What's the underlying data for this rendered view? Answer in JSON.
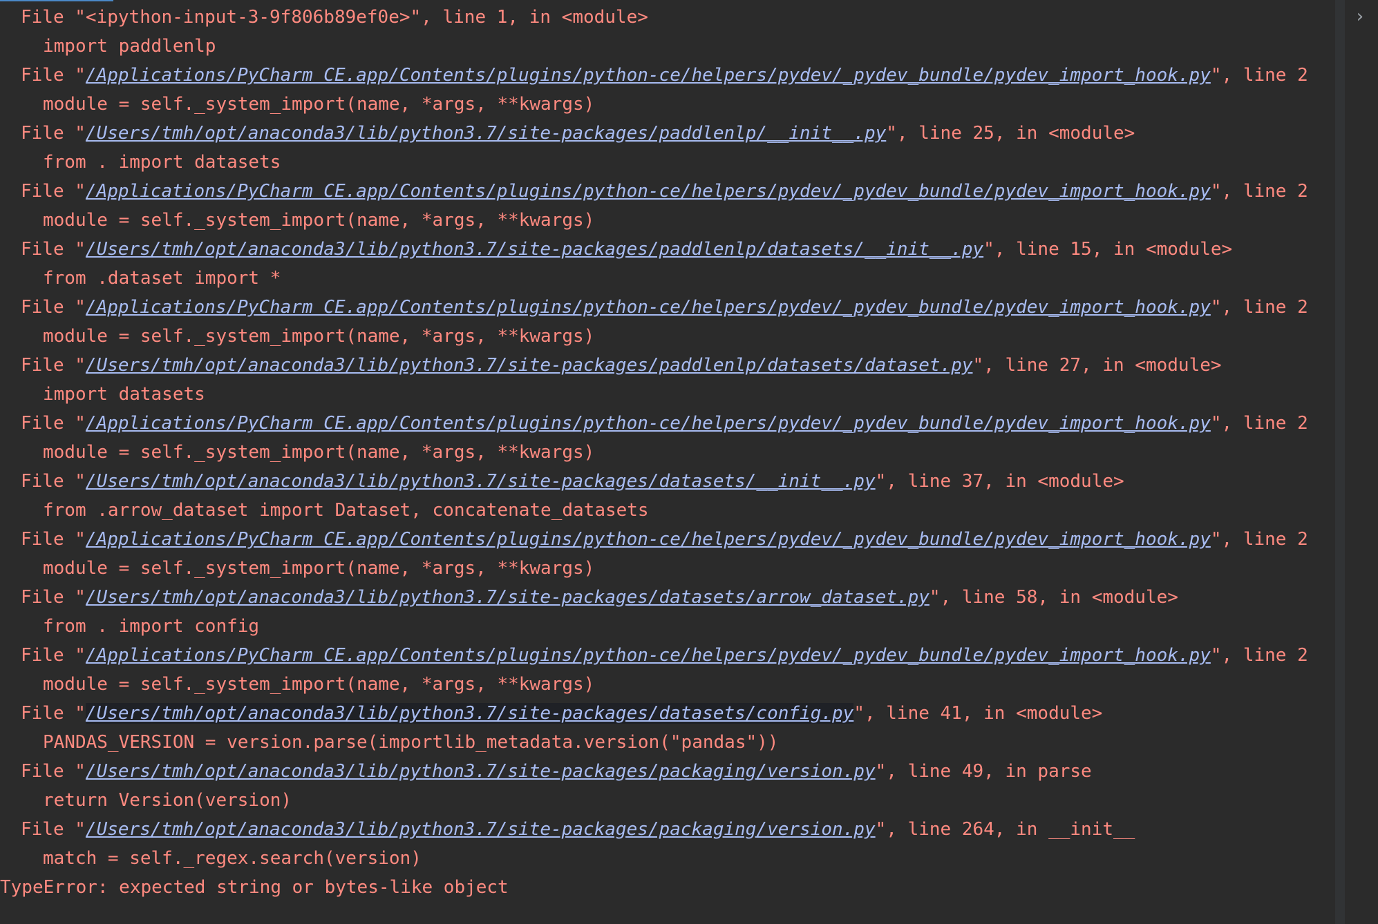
{
  "colors": {
    "background": "#2b2b2b",
    "error_text": "#ff8a80",
    "link": "#a8bcf2",
    "accent": "#4a88c7"
  },
  "icons": {
    "expand": "chevron-right-icon"
  },
  "traceback": [
    {
      "type": "file",
      "pre": "File \"",
      "link": "",
      "post": "<ipython-input-3-9f806b89ef0e>\", line 1, in <module>"
    },
    {
      "type": "code",
      "text": "import paddlenlp"
    },
    {
      "type": "file",
      "pre": "File \"",
      "link": "/Applications/PyCharm CE.app/Contents/plugins/python-ce/helpers/pydev/_pydev_bundle/pydev_import_hook.py",
      "post": "\", line 2"
    },
    {
      "type": "code",
      "text": "module = self._system_import(name, *args, **kwargs)"
    },
    {
      "type": "file",
      "pre": "File \"",
      "link": "/Users/tmh/opt/anaconda3/lib/python3.7/site-packages/paddlenlp/__init__.py",
      "post": "\", line 25, in <module>"
    },
    {
      "type": "code",
      "text": "from . import datasets"
    },
    {
      "type": "file",
      "pre": "File \"",
      "link": "/Applications/PyCharm CE.app/Contents/plugins/python-ce/helpers/pydev/_pydev_bundle/pydev_import_hook.py",
      "post": "\", line 2"
    },
    {
      "type": "code",
      "text": "module = self._system_import(name, *args, **kwargs)"
    },
    {
      "type": "file",
      "pre": "File \"",
      "link": "/Users/tmh/opt/anaconda3/lib/python3.7/site-packages/paddlenlp/datasets/__init__.py",
      "post": "\", line 15, in <module>"
    },
    {
      "type": "code",
      "text": "from .dataset import *"
    },
    {
      "type": "file",
      "pre": "File \"",
      "link": "/Applications/PyCharm CE.app/Contents/plugins/python-ce/helpers/pydev/_pydev_bundle/pydev_import_hook.py",
      "post": "\", line 2"
    },
    {
      "type": "code",
      "text": "module = self._system_import(name, *args, **kwargs)"
    },
    {
      "type": "file",
      "pre": "File \"",
      "link": "/Users/tmh/opt/anaconda3/lib/python3.7/site-packages/paddlenlp/datasets/dataset.py",
      "post": "\", line 27, in <module>"
    },
    {
      "type": "code",
      "text": "import datasets"
    },
    {
      "type": "file",
      "pre": "File \"",
      "link": "/Applications/PyCharm CE.app/Contents/plugins/python-ce/helpers/pydev/_pydev_bundle/pydev_import_hook.py",
      "post": "\", line 2"
    },
    {
      "type": "code",
      "text": "module = self._system_import(name, *args, **kwargs)"
    },
    {
      "type": "file",
      "pre": "File \"",
      "link": "/Users/tmh/opt/anaconda3/lib/python3.7/site-packages/datasets/__init__.py",
      "post": "\", line 37, in <module>"
    },
    {
      "type": "code",
      "text": "from .arrow_dataset import Dataset, concatenate_datasets"
    },
    {
      "type": "file",
      "pre": "File \"",
      "link": "/Applications/PyCharm CE.app/Contents/plugins/python-ce/helpers/pydev/_pydev_bundle/pydev_import_hook.py",
      "post": "\", line 2"
    },
    {
      "type": "code",
      "text": "module = self._system_import(name, *args, **kwargs)"
    },
    {
      "type": "file",
      "pre": "File \"",
      "link": "/Users/tmh/opt/anaconda3/lib/python3.7/site-packages/datasets/arrow_dataset.py",
      "post": "\", line 58, in <module>"
    },
    {
      "type": "code",
      "text": "from . import config"
    },
    {
      "type": "file",
      "pre": "File \"",
      "link": "/Applications/PyCharm CE.app/Contents/plugins/python-ce/helpers/pydev/_pydev_bundle/pydev_import_hook.py",
      "post": "\", line 2"
    },
    {
      "type": "code",
      "text": "module = self._system_import(name, *args, **kwargs)"
    },
    {
      "type": "file",
      "pre": "File \"",
      "link": "/Users/tmh/opt/anaconda3/lib/python3.7/site-packages/datasets/config.py",
      "post": "\", line 41, in <module>",
      "hover": true
    },
    {
      "type": "code",
      "text": "PANDAS_VERSION = version.parse(importlib_metadata.version(\"pandas\"))"
    },
    {
      "type": "file",
      "pre": "File \"",
      "link": "/Users/tmh/opt/anaconda3/lib/python3.7/site-packages/packaging/version.py",
      "post": "\", line 49, in parse"
    },
    {
      "type": "code",
      "text": "return Version(version)"
    },
    {
      "type": "file",
      "pre": "File \"",
      "link": "/Users/tmh/opt/anaconda3/lib/python3.7/site-packages/packaging/version.py",
      "post": "\", line 264, in __init__"
    },
    {
      "type": "code",
      "text": "match = self._regex.search(version)"
    },
    {
      "type": "err",
      "text": "TypeError: expected string or bytes-like object"
    }
  ]
}
